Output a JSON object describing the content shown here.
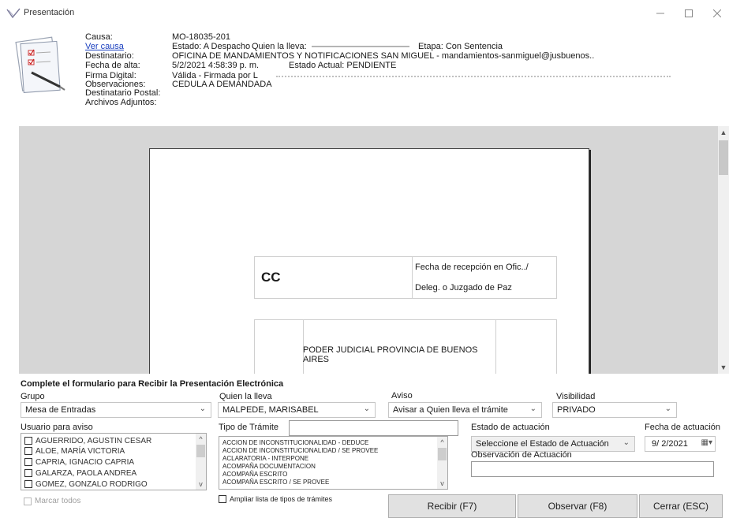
{
  "window": {
    "title": "Presentación"
  },
  "header": {
    "labels": {
      "causa": "Causa:",
      "destinatario": "Destinatario:",
      "fecha_alta": "Fecha de alta:",
      "firma": "Firma Digital:",
      "observaciones": "Observaciones:",
      "destinatario_postal": "Destinatario Postal:",
      "archivos": "Archivos Adjuntos:"
    },
    "ver_causa_link": "Ver causa",
    "causa_value": "MO-18035-201",
    "estado_line": "Estado: A Despacho",
    "quien_lleva_line": "Quien la lleva:",
    "etapa_line": "Etapa: Con Sentencia",
    "destinatario_value": "OFICINA DE MANDAMIENTOS Y NOTIFICACIONES SAN MIGUEL - mandamientos-sanmiguel@jusbuenos..",
    "fecha_alta_value": "5/2/2021 4:58:39 p. m.",
    "estado_actual": "Estado Actual: PENDIENTE",
    "firma_value": "Válida - Firmada por L",
    "observaciones_value": "CEDULA A DEMANDADA"
  },
  "document": {
    "cc": "CC",
    "fecha_recepcion_1": "Fecha de recepción en Ofic../",
    "fecha_recepcion_2": "Deleg. o Juzgado de Paz",
    "poder_judicial": "PODER JUDICIAL PROVINCIA DE BUENOS AIRES"
  },
  "form": {
    "title": "Complete el formulario para Recibir la Presentación Electrónica",
    "grupo_label": "Grupo",
    "grupo_value": "Mesa de Entradas",
    "quien_label": "Quien la lleva",
    "quien_value": "MALPEDE, MARISABEL",
    "aviso_label": "Aviso",
    "aviso_value": "Avisar a Quien lleva el trámite",
    "visibilidad_label": "Visibilidad",
    "visibilidad_value": "PRIVADO",
    "usuario_label": "Usuario para aviso",
    "usuarios": [
      "AGUERRIDO, AGUSTIN CESAR",
      "ALOE, MARÍA VICTORIA",
      "CAPRIA, IGNACIO CAPRIA",
      "GALARZA, PAOLA ANDREA",
      "GOMEZ, GONZALO RODRIGO"
    ],
    "marcar_todos": "Marcar todos",
    "tipo_tramite_label": "Tipo de Trámite",
    "tipo_tramite_value": "",
    "tramites": [
      "ACCION DE INCONSTITUCIONALIDAD - DEDUCE",
      "ACCION DE INCONSTITUCIONALIDAD / SE PROVEE",
      "ACLARATORIA - INTERPONE",
      "ACOMPAÑA DOCUMENTACION",
      "ACOMPAÑA ESCRITO",
      "ACOMPAÑA ESCRITO / SE PROVEE"
    ],
    "ampliar_label": "Ampliar lista de tipos de trámites",
    "estado_actuacion_label": "Estado de actuación",
    "estado_actuacion_value": "Seleccione el Estado de Actuación",
    "fecha_actuacion_label": "Fecha de actuación",
    "fecha_actuacion_value": "9/ 2/2021",
    "observacion_label": "Observación de Actuación",
    "observacion_value": ""
  },
  "buttons": {
    "recibir": "Recibir (F7)",
    "observar": "Observar (F8)",
    "cerrar": "Cerrar (ESC)"
  }
}
